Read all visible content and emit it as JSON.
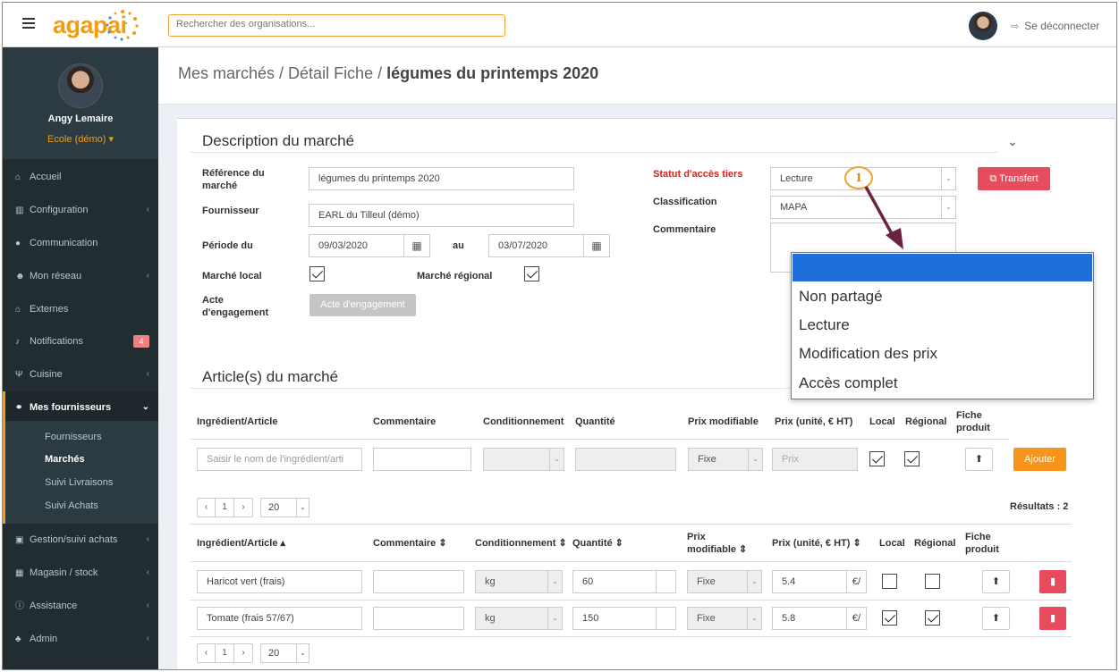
{
  "topbar": {
    "logo": "agapai",
    "search_placeholder": "Rechercher des organisations...",
    "logout_label": "Se déconnecter"
  },
  "sidebar": {
    "user_name": "Angy Lemaire",
    "user_org": "Ecole (démo) ▾",
    "items": [
      {
        "label": "Accueil",
        "icon": "home-icon"
      },
      {
        "label": "Configuration",
        "icon": "bank-icon"
      },
      {
        "label": "Communication",
        "icon": "comments-icon"
      },
      {
        "label": "Mon réseau",
        "icon": "users-icon"
      },
      {
        "label": "Externes",
        "icon": "home-icon"
      },
      {
        "label": "Notifications",
        "icon": "bell-icon",
        "badge": "4"
      },
      {
        "label": "Cuisine",
        "icon": "cutlery-icon"
      },
      {
        "label": "Mes fournisseurs",
        "icon": "handshake-icon"
      },
      {
        "label": "Gestion/suivi achats",
        "icon": "cart-icon"
      },
      {
        "label": "Magasin / stock",
        "icon": "cubes-icon"
      },
      {
        "label": "Assistance",
        "icon": "info-icon"
      },
      {
        "label": "Admin",
        "icon": "user-plus-icon"
      }
    ],
    "submenu": [
      "Fournisseurs",
      "Marchés",
      "Suivi Livraisons",
      "Suivi Achats"
    ]
  },
  "breadcrumb": {
    "part1": "Mes marchés",
    "sep": " / ",
    "part2": "Détail Fiche",
    "current": "légumes du printemps 2020"
  },
  "description": {
    "title": "Description du marché",
    "ref_label": "Référence du marché",
    "ref_value": "légumes du printemps 2020",
    "fournisseur_label": "Fournisseur",
    "fournisseur_value": "EARL du Tilleul (démo)",
    "periode_label": "Période du",
    "date_from": "09/03/2020",
    "au_label": "au",
    "date_to": "03/07/2020",
    "local_label": "Marché local",
    "regional_label": "Marché régional",
    "acte_label": "Acte d'engagement",
    "acte_button": "Acte d'engagement",
    "statut_label": "Statut d'accès tiers",
    "statut_value": "Lecture",
    "classification_label": "Classification",
    "classification_value": "MAPA",
    "commentaire_label": "Commentaire",
    "transfert_button": "Transfert"
  },
  "callout": "1",
  "dropdown": {
    "options": [
      "Non partagé",
      "Lecture",
      "Modification des prix",
      "Accès complet"
    ]
  },
  "articles": {
    "title": "Article(s) du marché",
    "headers": [
      "Ingrédient/Article",
      "Commentaire",
      "Conditionnement",
      "Quantité",
      "Prix modifiable",
      "Prix (unité, € HT)",
      "Local",
      "Régional",
      "Fiche produit"
    ],
    "sort_headers": [
      "Ingrédient/Article ▴",
      "Commentaire ⇕",
      "Conditionnement ⇕",
      "Quantité ⇕",
      "Prix modifiable ⇕",
      "Prix (unité, € HT) ⇕",
      "Local",
      "Régional",
      "Fiche produit"
    ],
    "new_row": {
      "ingredient_placeholder": "Saisir le nom de l'ingrédient/arti",
      "prix_mode": "Fixe",
      "prix_placeholder": "Prix",
      "add_button": "Ajouter"
    },
    "pager": {
      "prev": "‹",
      "page": "1",
      "next": "›",
      "per_page": "20"
    },
    "results": "Résultats : 2",
    "rows": [
      {
        "ingredient": "Haricot vert (frais)",
        "conditionnement": "kg",
        "quantite": "60",
        "prix_mode": "Fixe",
        "prix": "5.4",
        "unit": "€/",
        "local": false,
        "regional": false
      },
      {
        "ingredient": "Tomate (frais  57/67)",
        "conditionnement": "kg",
        "quantite": "150",
        "prix_mode": "Fixe",
        "prix": "5.8",
        "unit": "€/",
        "local": true,
        "regional": true
      }
    ]
  }
}
